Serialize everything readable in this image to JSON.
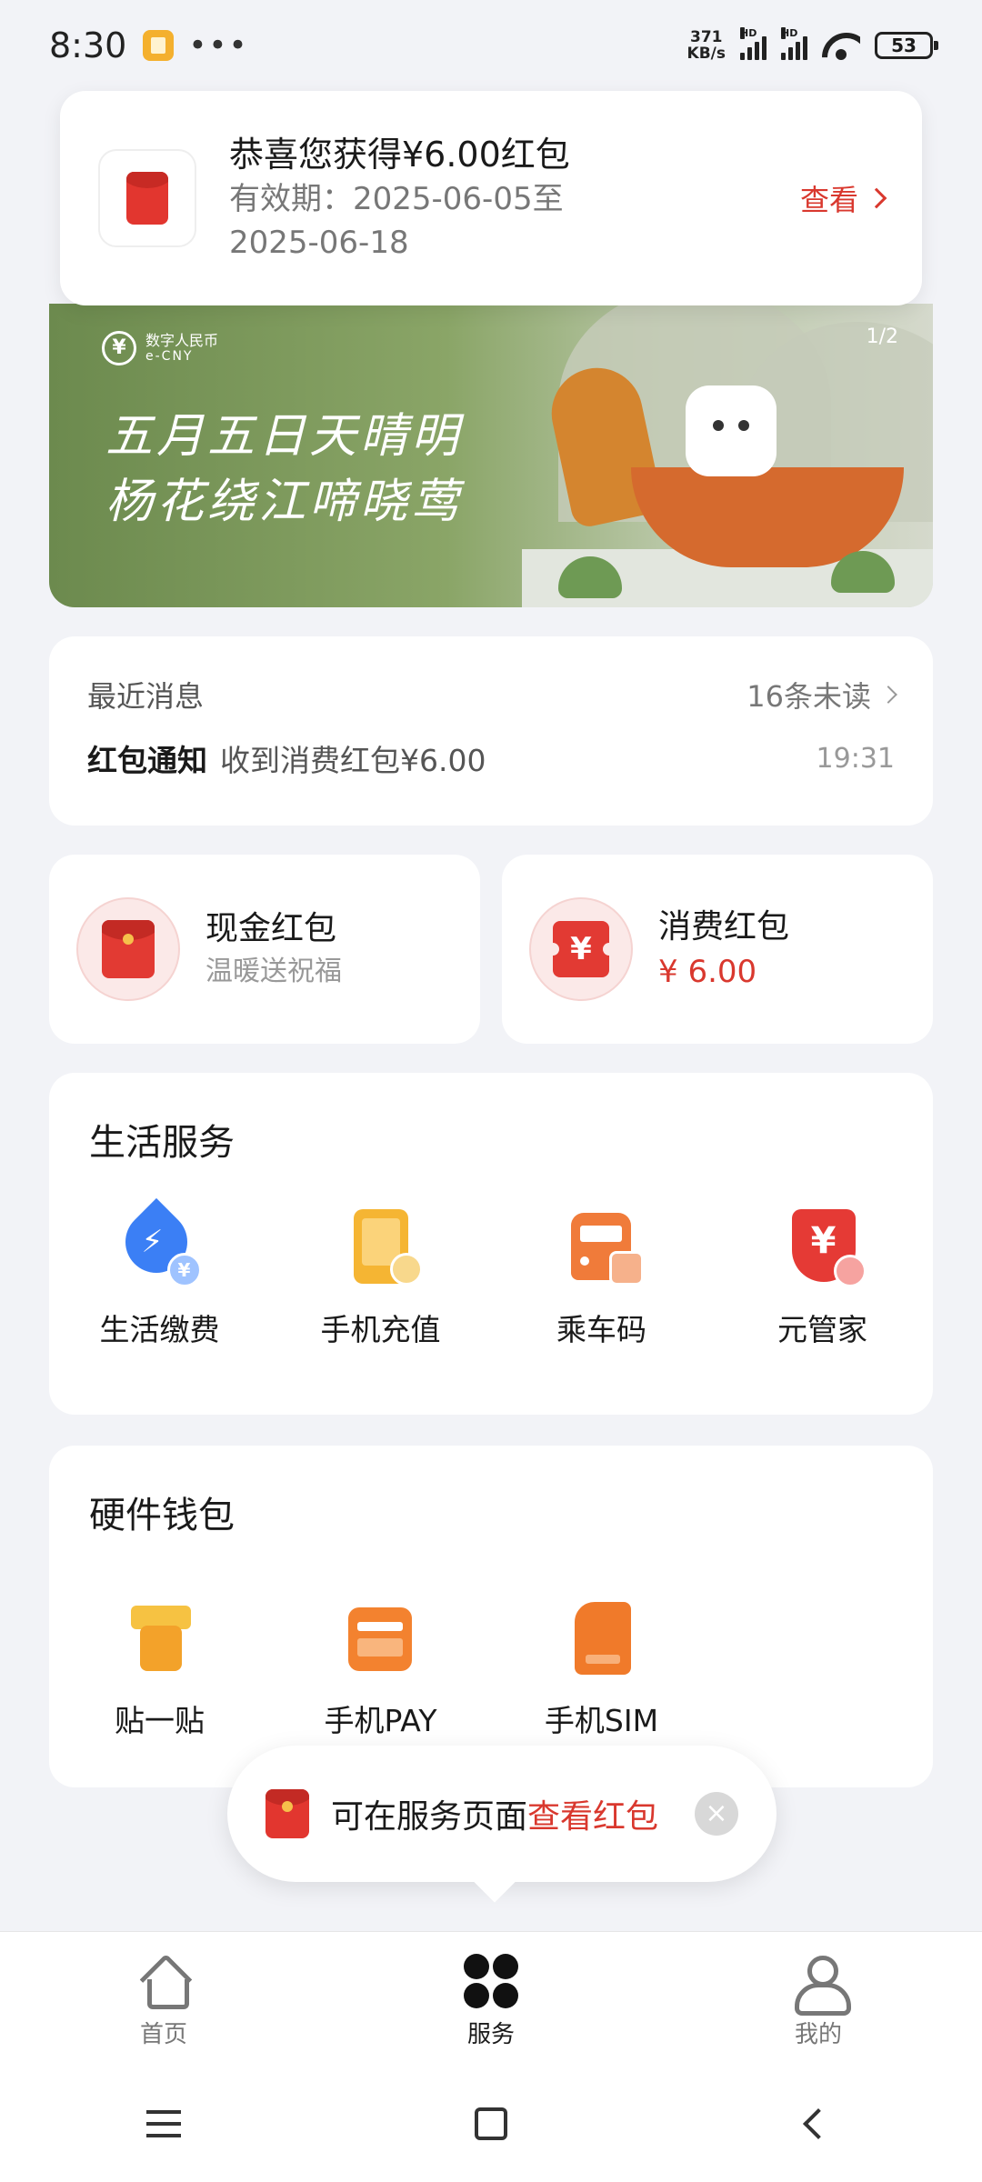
{
  "status_bar": {
    "time": "8:30",
    "network_speed_value": "371",
    "network_speed_unit": "KB/s",
    "signal_label": "HD",
    "battery": "53"
  },
  "notice": {
    "title": "恭喜您获得¥6.00红包",
    "validity": "有效期：2025-06-05至2025-06-18",
    "link_label": "查看",
    "icon": "red-envelope-icon"
  },
  "banner": {
    "logo_cn": "数字人民币",
    "logo_en": "e-CNY",
    "page_indicator": "1/2",
    "poem_line1": "五月五日天晴明",
    "poem_line2": "杨花绕江啼晓莺"
  },
  "messages": {
    "label": "最近消息",
    "unread": "16条未读",
    "type": "红包通知",
    "body": "收到消费红包¥6.00",
    "time": "19:31"
  },
  "red_packets": {
    "cash": {
      "title": "现金红包",
      "subtitle": "温暖送祝福",
      "icon": "red-envelope-icon"
    },
    "consume": {
      "title": "消费红包",
      "amount": "¥ 6.00",
      "icon": "yuan-ticket-icon"
    }
  },
  "life_services": {
    "title": "生活服务",
    "items": [
      {
        "label": "生活缴费",
        "icon": "utility-bill-icon"
      },
      {
        "label": "手机充值",
        "icon": "phone-recharge-icon"
      },
      {
        "label": "乘车码",
        "icon": "bus-code-icon"
      },
      {
        "label": "元管家",
        "icon": "yuan-shield-icon"
      }
    ]
  },
  "hardware_wallet": {
    "title": "硬件钱包",
    "items": [
      {
        "label": "贴一贴",
        "icon": "tap-phone-icon"
      },
      {
        "label": "手机PAY",
        "icon": "phone-pay-card-icon"
      },
      {
        "label": "手机SIM",
        "icon": "sim-card-icon"
      }
    ]
  },
  "toast": {
    "text": "可在服务页面",
    "link": "查看红包",
    "close_icon": "close-icon"
  },
  "bottom_nav": {
    "items": [
      {
        "label": "首页",
        "icon": "home-icon",
        "active": false
      },
      {
        "label": "服务",
        "icon": "services-grid-icon",
        "active": true
      },
      {
        "label": "我的",
        "icon": "profile-icon",
        "active": false
      }
    ]
  },
  "colors": {
    "accent_red": "#d9382e",
    "background": "#f2f3f7",
    "card": "#ffffff"
  }
}
